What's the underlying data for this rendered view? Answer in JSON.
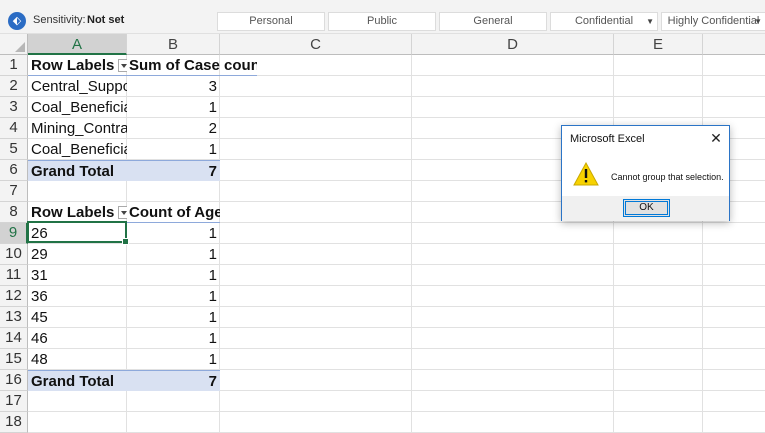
{
  "sensitivity": {
    "label": "Sensitivity:",
    "value": "Not set",
    "options": [
      "Personal",
      "Public",
      "General",
      "Confidential",
      "Highly Confidential"
    ]
  },
  "columns": [
    "A",
    "B",
    "C",
    "D",
    "E"
  ],
  "rows": [
    "1",
    "2",
    "3",
    "4",
    "5",
    "6",
    "7",
    "8",
    "9",
    "10",
    "11",
    "12",
    "13",
    "14",
    "15",
    "16",
    "17",
    "18"
  ],
  "pivot1": {
    "header_a": "Row Labels",
    "header_b": "Sum of Case count",
    "rows": [
      {
        "label": "Central_Suppc",
        "value": "3"
      },
      {
        "label": "Coal_Beneficia",
        "value": "1"
      },
      {
        "label": "Mining_Contra",
        "value": "2"
      },
      {
        "label": "Coal_Beneficia",
        "value": "1"
      }
    ],
    "total_label": "Grand Total",
    "total_value": "7"
  },
  "pivot2": {
    "header_a": "Row Labels",
    "header_b": "Count of Age",
    "rows": [
      {
        "label": "26",
        "value": "1"
      },
      {
        "label": "29",
        "value": "1"
      },
      {
        "label": "31",
        "value": "1"
      },
      {
        "label": "36",
        "value": "1"
      },
      {
        "label": "45",
        "value": "1"
      },
      {
        "label": "46",
        "value": "1"
      },
      {
        "label": "48",
        "value": "1"
      }
    ],
    "total_label": "Grand Total",
    "total_value": "7"
  },
  "dialog": {
    "title": "Microsoft Excel",
    "close": "✕",
    "message": "Cannot group that selection.",
    "ok_label": "OK"
  },
  "colors": {
    "accent": "#217346",
    "pivot_band": "#d9e1f2",
    "dialog_border": "#2b74c6"
  }
}
